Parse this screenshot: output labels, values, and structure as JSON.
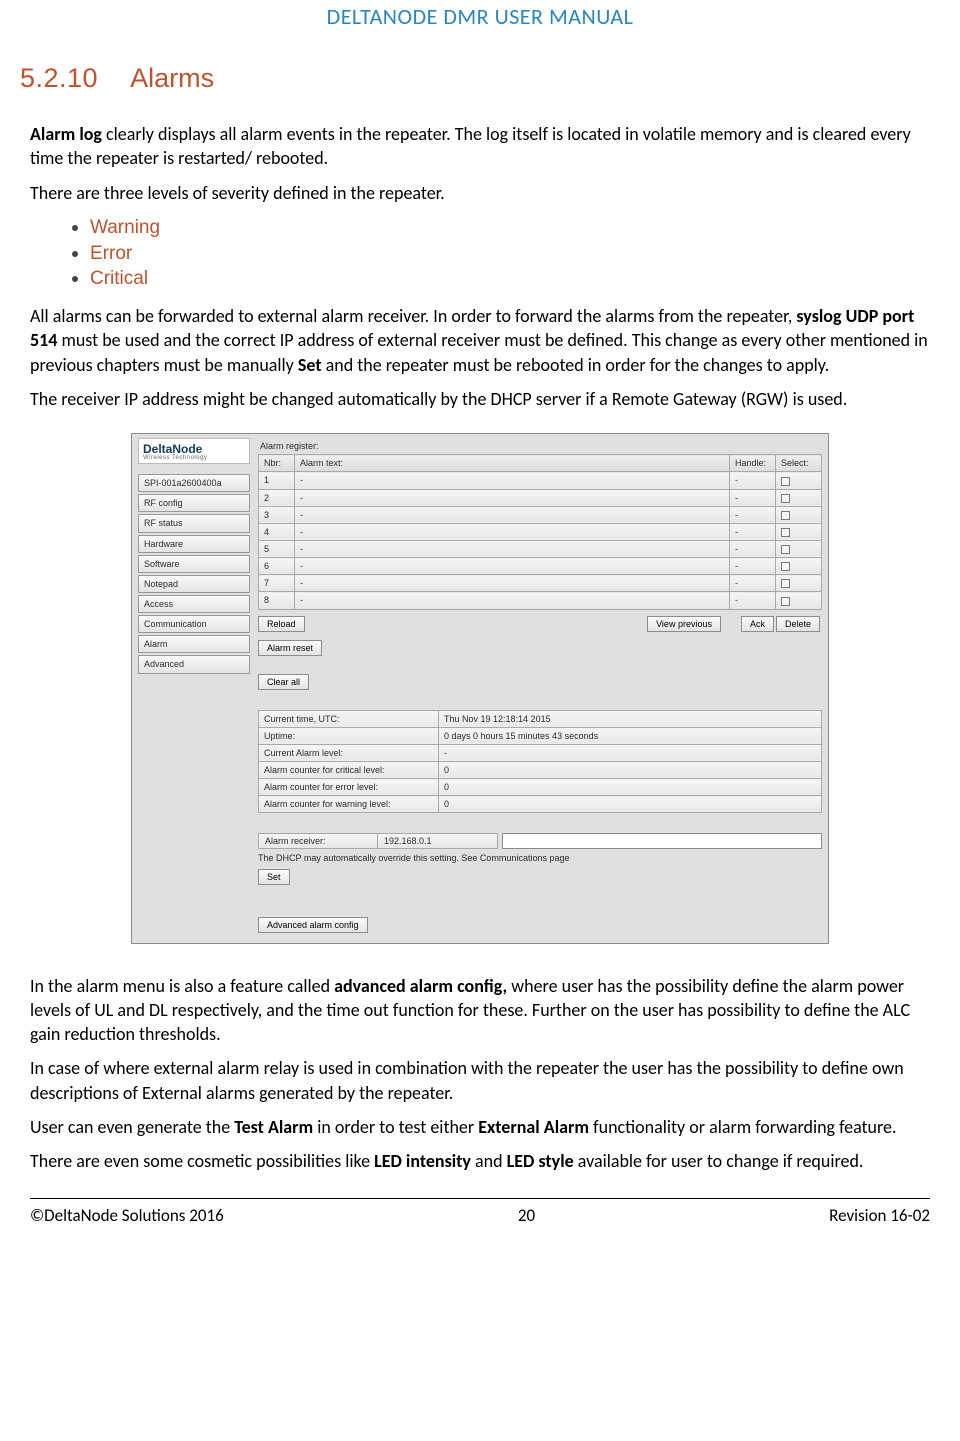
{
  "header": {
    "title": "DELTANODE DMR USER MANUAL"
  },
  "section": {
    "number": "5.2.10",
    "title": "Alarms"
  },
  "para": {
    "p1a": "Alarm log",
    "p1b": " clearly displays all alarm events in the repeater. The log itself is located in volatile memory and is cleared every time the repeater is restarted/ rebooted.",
    "p2": "There are three levels of severity defined in the repeater.",
    "p3a": "All alarms can be forwarded to external alarm receiver. In order to forward the alarms from the repeater, ",
    "p3b": "syslog UDP port 514",
    "p3c": " must be used and the correct IP address of external receiver must be defined. This change as every other mentioned in previous chapters must be manually ",
    "p3d": "Set",
    "p3e": " and the repeater must be rebooted in order for the changes to apply.",
    "p4": "The receiver IP address might be changed automatically by the DHCP server if a Remote Gateway (RGW) is used.",
    "p5a": "In the alarm menu is also a feature called ",
    "p5b": "advanced alarm config,",
    "p5c": " where user has the possibility define the alarm power levels of UL and DL respectively, and the time out function for these. Further on the user has possibility to define the ALC gain reduction thresholds.",
    "p6": "In case of where external alarm relay is used in combination with the repeater the user has the possibility to define own descriptions of External alarms generated by the repeater.",
    "p7a": "User can even generate the ",
    "p7b": "Test Alarm",
    "p7c": " in order to test either ",
    "p7d": "External Alarm",
    "p7e": " functionality or alarm forwarding feature.",
    "p8a": "There are even some cosmetic possibilities like ",
    "p8b": "LED intensity",
    "p8c": " and ",
    "p8d": "LED style",
    "p8e": " available for user to change if required."
  },
  "severity": [
    "Warning",
    "Error",
    "Critical"
  ],
  "ui": {
    "logo": {
      "brand": "DeltaNode",
      "sub": "Wireless   Technology"
    },
    "nav": [
      "SPI-001a2600400a",
      "RF config",
      "RF status",
      "Hardware",
      "Software",
      "Notepad",
      "Access",
      "Communication",
      "Alarm",
      "Advanced"
    ],
    "register_label": "Alarm register:",
    "cols": {
      "nbr": "Nbr:",
      "text": "Alarm text:",
      "handle": "Handle:",
      "select": "Select:"
    },
    "rows": [
      {
        "n": "1",
        "t": "-",
        "h": "-"
      },
      {
        "n": "2",
        "t": "-",
        "h": "-"
      },
      {
        "n": "3",
        "t": "-",
        "h": "-"
      },
      {
        "n": "4",
        "t": "-",
        "h": "-"
      },
      {
        "n": "5",
        "t": "-",
        "h": "-"
      },
      {
        "n": "6",
        "t": "-",
        "h": "-"
      },
      {
        "n": "7",
        "t": "-",
        "h": "-"
      },
      {
        "n": "8",
        "t": "-",
        "h": "-"
      }
    ],
    "buttons": {
      "reload": "Reload",
      "view_prev": "View previous",
      "ack": "Ack",
      "delete": "Delete",
      "alarm_reset": "Alarm reset",
      "clear_all": "Clear all",
      "set": "Set",
      "adv": "Advanced alarm config"
    },
    "status": [
      {
        "k": "Current time, UTC:",
        "v": "Thu Nov 19 12:18:14 2015"
      },
      {
        "k": "Uptime:",
        "v": "0 days 0 hours 15 minutes 43 seconds"
      },
      {
        "k": "Current Alarm level:",
        "v": "-"
      },
      {
        "k": "Alarm counter for critical level:",
        "v": "0"
      },
      {
        "k": "Alarm counter for error level:",
        "v": "0"
      },
      {
        "k": "Alarm counter for warning level:",
        "v": "0"
      }
    ],
    "receiver": {
      "label": "Alarm receiver:",
      "value": "192.168.0.1",
      "note": "The DHCP may automatically override this setting. See Communications page"
    }
  },
  "footer": {
    "left": "©DeltaNode Solutions 2016",
    "center": "20",
    "right": "Revision 16-02"
  }
}
